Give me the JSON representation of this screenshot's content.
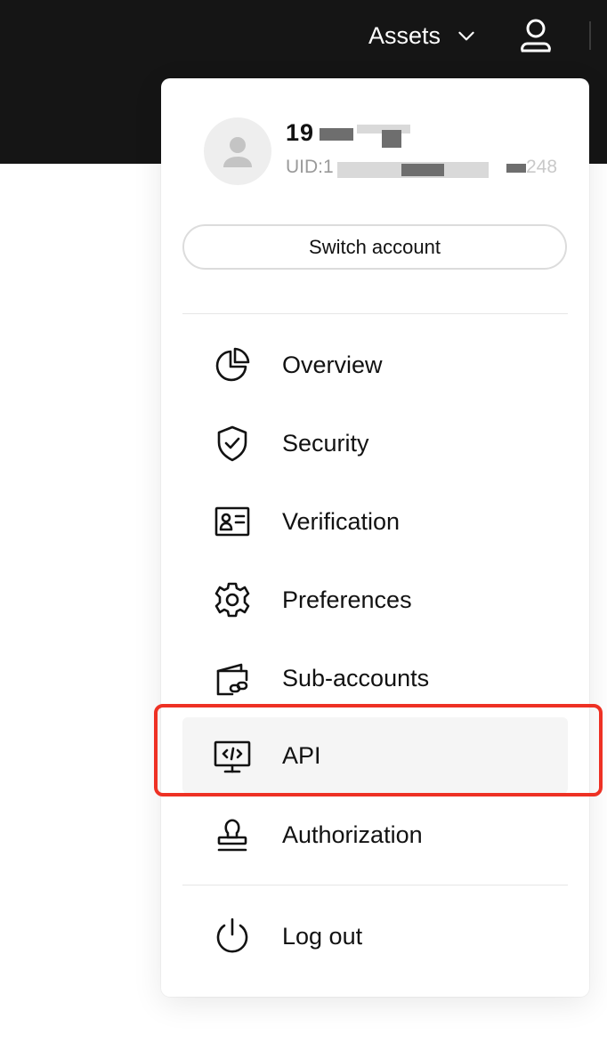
{
  "header": {
    "assets_label": "Assets"
  },
  "profile": {
    "username": "19",
    "uid_prefix": "UID:1",
    "uid_suffix": "248"
  },
  "menu": {
    "switch_account_label": "Switch account",
    "items": [
      {
        "label": "Overview",
        "icon": "pie-chart-icon"
      },
      {
        "label": "Security",
        "icon": "shield-check-icon"
      },
      {
        "label": "Verification",
        "icon": "id-card-icon"
      },
      {
        "label": "Preferences",
        "icon": "gear-icon"
      },
      {
        "label": "Sub-accounts",
        "icon": "wallet-link-icon"
      },
      {
        "label": "API",
        "icon": "api-monitor-icon"
      },
      {
        "label": "Authorization",
        "icon": "stamp-icon"
      }
    ],
    "logout_label": "Log out"
  },
  "colors": {
    "topbar": "#151515",
    "highlight": "#ee3124",
    "hover_bg": "#f5f5f5"
  }
}
